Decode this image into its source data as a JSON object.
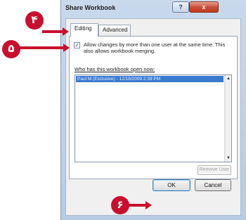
{
  "dialog": {
    "title": "Share Workbook",
    "help_glyph": "?",
    "close_glyph": "x"
  },
  "tabs": [
    {
      "label": "Editing"
    },
    {
      "label": "Advanced"
    }
  ],
  "editing": {
    "checkbox_checked": true,
    "checkbox_glyph": "✓",
    "checkbox_label": "Allow changes by more than one user at the same time. This also allows workbook merging.",
    "who_label": "Who has this workbook open now:",
    "users": [
      "Paul M (Exclusive) - 12/18/2009 2:39 PM"
    ],
    "remove_user_label": "Remove User",
    "scroll_up_glyph": "▲",
    "scroll_down_glyph": "▼"
  },
  "buttons": {
    "ok": "OK",
    "cancel": "Cancel"
  },
  "callouts": {
    "step_tab": "۴",
    "step_checkbox": "۵",
    "step_ok": "۶"
  },
  "colors": {
    "callout": "#c8102e",
    "selection": "#3a7bd0"
  }
}
